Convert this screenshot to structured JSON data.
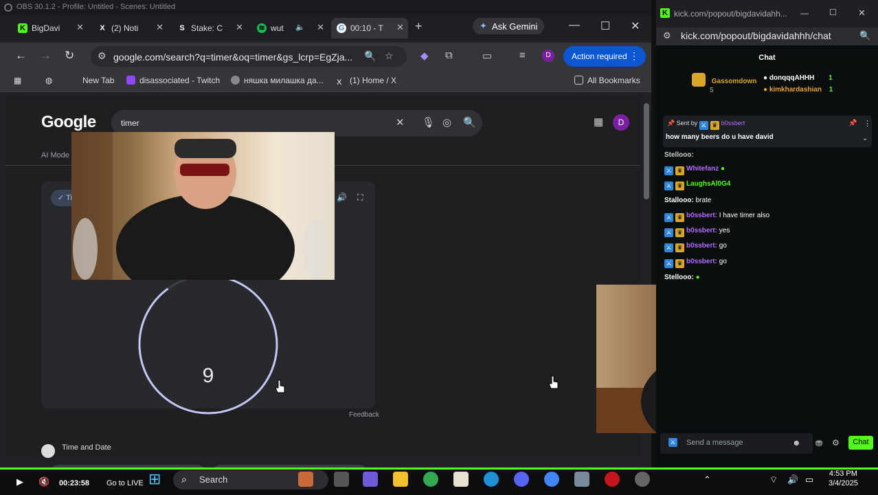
{
  "obs_title": "OBS 30.1.2 - Profile: Untitled - Scenes: Untitled",
  "browser": {
    "tabs": [
      {
        "label": "BigDavi",
        "icon": "kick-icon",
        "color": "#53fc18"
      },
      {
        "label": "(2) Noti",
        "icon": "x-icon",
        "color": "#ffffff"
      },
      {
        "label": "Stake: C",
        "icon": "stake-icon",
        "color": "#ffffff"
      },
      {
        "label": "wut",
        "icon": "spotify-icon",
        "color": "#1db954"
      },
      {
        "label": "00:10 - T",
        "icon": "google-icon",
        "color": "#4285f4"
      }
    ],
    "gemini_label": "Ask Gemini",
    "url": "google.com/search?q=timer&oq=timer&gs_lcrp=EgZja...",
    "action_required": "Action required",
    "profile_initial": "D",
    "bookmarks": [
      "New Tab",
      "disassociated - Twitch",
      "няшка милашка да...",
      "(1) Home / X"
    ],
    "all_bookmarks": "All Bookmarks"
  },
  "google": {
    "logo": "Google",
    "query": "timer",
    "ai_mode": "AI Mode",
    "avatar": "D",
    "timer_tab": "Ti",
    "timer_value": "9",
    "timer_progress": 0.9,
    "pause_icon": "⏸",
    "reset_icon": "↻",
    "feedback": "Feedback",
    "result_title": "Time and Date"
  },
  "kick": {
    "tab_title": "kick.com/popout/bigdavidahh...",
    "url": "kick.com/popout/bigdavidahhh/chat",
    "chat_title": "Chat",
    "leaderboard": [
      {
        "name": "Gassomdown",
        "sub": "5",
        "color": "#d9a629"
      },
      {
        "name": "donqqqAHHH",
        "sub": "1",
        "color": "#ffffff"
      },
      {
        "name": "kimkhardashian",
        "sub": "1",
        "color": "#e8a33d"
      }
    ],
    "pinned": {
      "prefix": "Sent by",
      "user": "b0ssbert",
      "text": "how many beers do u have david"
    },
    "messages": [
      {
        "user": "Stellooo:",
        "text": "",
        "color": "#ffffff"
      },
      {
        "user": "Whitefanz",
        "text": "",
        "color": "#b46aff"
      },
      {
        "user": "LaughsAl0G4",
        "text": "",
        "color": "#53fc18"
      },
      {
        "user": "Stallooo:",
        "text": "brate",
        "color": "#ffffff"
      },
      {
        "user": "b0ssbert:",
        "text": "I have timer also",
        "color": "#b46aff"
      },
      {
        "user": "b0ssbert:",
        "text": "yes",
        "color": "#b46aff"
      },
      {
        "user": "b0ssbert:",
        "text": "go",
        "color": "#b46aff"
      },
      {
        "user": "b0ssbert:",
        "text": "go",
        "color": "#b46aff"
      },
      {
        "user": "Stellooo:",
        "text": "",
        "color": "#ffffff"
      }
    ],
    "input_placeholder": "Send a message",
    "chat_button": "Chat"
  },
  "player": {
    "timecode": "00:23:58",
    "go_live": "Go to LIVE",
    "search": "Search",
    "time": "4:53 PM",
    "date": "3/4/2025"
  }
}
